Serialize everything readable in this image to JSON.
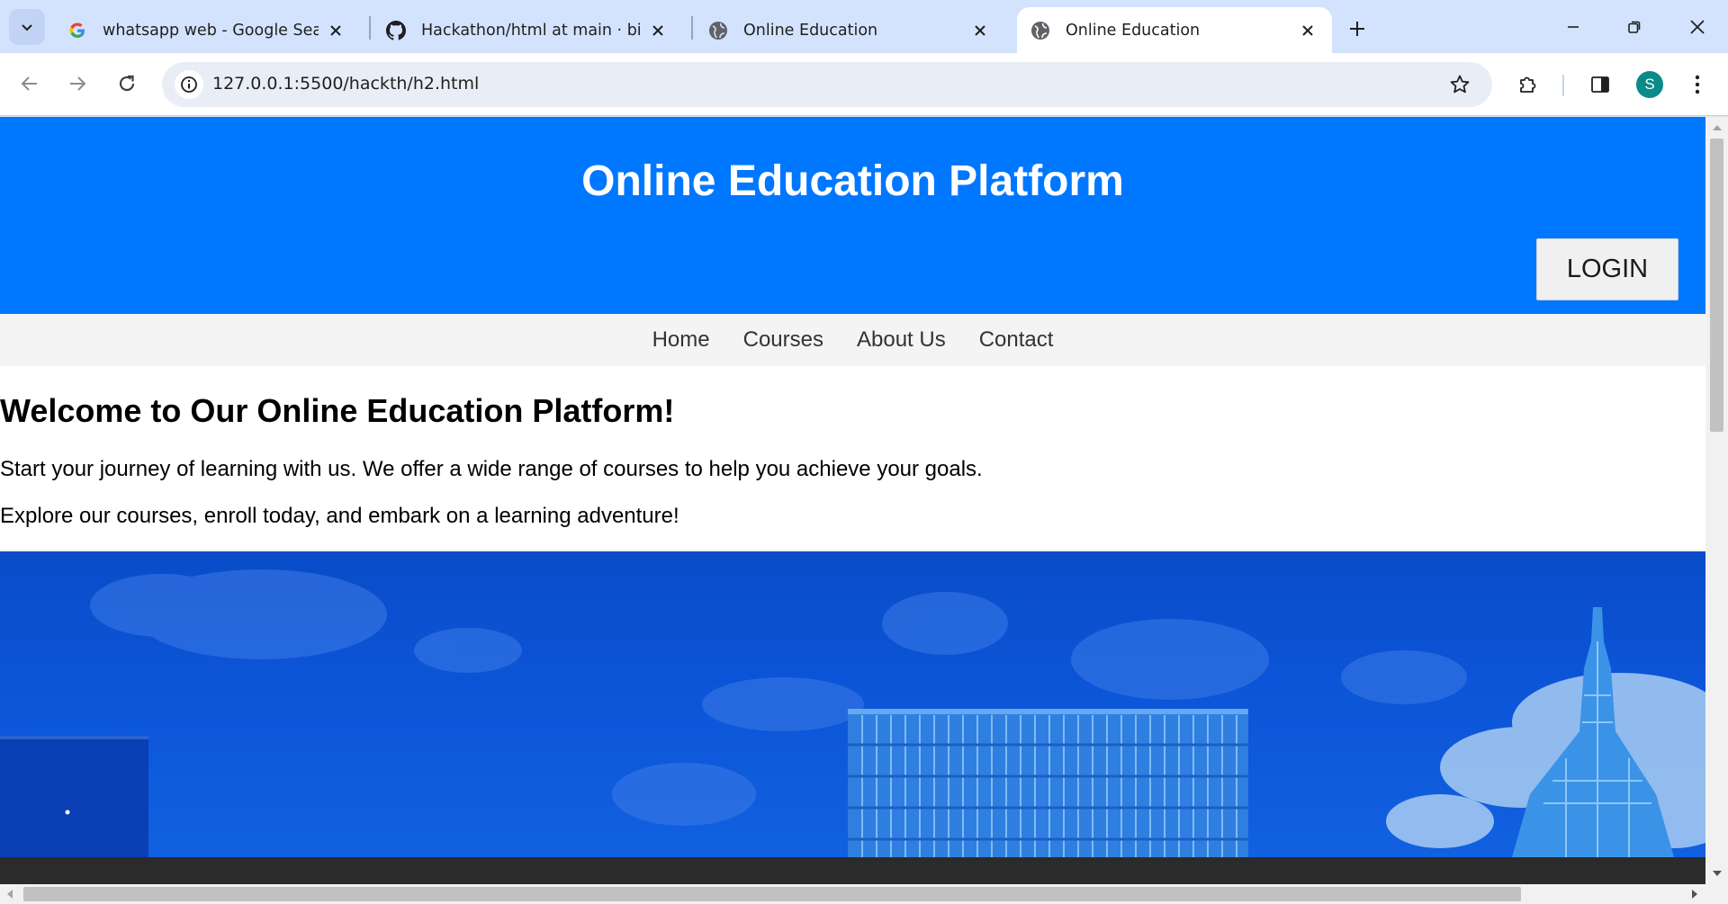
{
  "browser": {
    "tabs": [
      {
        "title": "whatsapp web - Google Search",
        "favicon": "google-icon",
        "active": false
      },
      {
        "title": "Hackathon/html at main · bipul",
        "favicon": "github-icon",
        "active": false
      },
      {
        "title": "Online Education",
        "favicon": "globe-icon",
        "active": false
      },
      {
        "title": "Online Education",
        "favicon": "globe-icon",
        "active": true
      }
    ],
    "url": "127.0.0.1:5500/hackth/h2.html",
    "profile_initial": "S",
    "colors": {
      "tabstrip": "#d3e3fd",
      "omnibox": "#e9eef6",
      "avatar": "#0b8a8a"
    }
  },
  "page": {
    "header_title": "Online Education Platform",
    "login_label": "LOGIN",
    "nav": [
      "Home",
      "Courses",
      "About Us",
      "Contact"
    ],
    "welcome_heading": "Welcome to Our Online Education Platform!",
    "paragraphs": [
      "Start your journey of learning with us. We offer a wide range of courses to help you achieve your goals.",
      "Explore our courses, enroll today, and embark on a learning adventure!"
    ],
    "hero_image": "city-skyline-image",
    "colors": {
      "header": "#0077ff",
      "nav_bg": "#f4f4f4",
      "footer": "#2b2b2b"
    }
  }
}
